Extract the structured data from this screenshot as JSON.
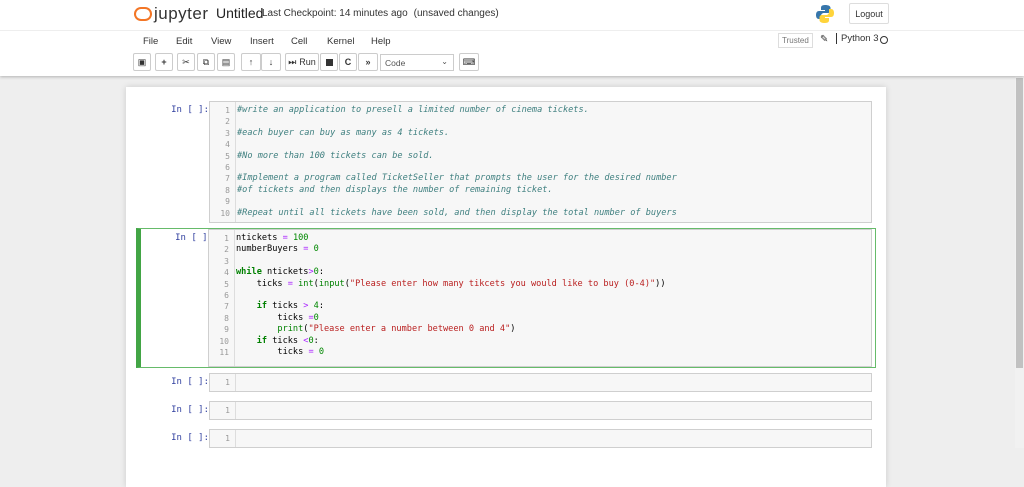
{
  "header": {
    "logo": "jupyter",
    "notebook_name": "Untitled",
    "checkpoint": "Last Checkpoint: 14 minutes ago",
    "unsaved": "(unsaved changes)",
    "logout": "Logout"
  },
  "menu": [
    "File",
    "Edit",
    "View",
    "Insert",
    "Cell",
    "Kernel",
    "Help"
  ],
  "kernel": {
    "trusted": "Trusted",
    "name": "Python 3"
  },
  "toolbar": {
    "run": "Run",
    "cell_type": "Code"
  },
  "cells": [
    {
      "prompt": "In [ ]:",
      "lines": [
        [
          [
            "#write an application to presell a limited number of cinema tickets.",
            "c"
          ]
        ],
        [],
        [
          [
            "#each buyer can buy as many as 4 tickets.",
            "c"
          ]
        ],
        [],
        [
          [
            "#No more than 100 tickets can be sold.",
            "c"
          ]
        ],
        [],
        [
          [
            "#Implement a program called TicketSeller that prompts the user for the desired number",
            "c"
          ]
        ],
        [
          [
            "#of tickets and then displays the number of remaining ticket.",
            "c"
          ]
        ],
        [],
        [
          [
            "#Repeat until all tickets have been sold, and then display the total number of buyers",
            "c"
          ]
        ]
      ]
    },
    {
      "prompt": "In [ ]:",
      "lines": [
        [
          [
            "ntickets ",
            ""
          ],
          [
            "=",
            "o"
          ],
          [
            " ",
            ""
          ],
          [
            "100",
            "n"
          ]
        ],
        [
          [
            "numberBuyers ",
            ""
          ],
          [
            "=",
            "o"
          ],
          [
            " ",
            ""
          ],
          [
            "0",
            "n"
          ]
        ],
        [],
        [
          [
            "while",
            "k"
          ],
          [
            " ntickets",
            ""
          ],
          [
            ">",
            "o"
          ],
          [
            "0",
            "n"
          ],
          [
            ":",
            ""
          ]
        ],
        [
          [
            "    ticks ",
            ""
          ],
          [
            "=",
            "o"
          ],
          [
            " ",
            ""
          ],
          [
            "int",
            "b"
          ],
          [
            "(",
            ""
          ],
          [
            "input",
            "b"
          ],
          [
            "(",
            ""
          ],
          [
            "\"Please enter how many tikcets you would like to buy (0-4)\"",
            "s"
          ],
          [
            "))",
            ""
          ]
        ],
        [],
        [
          [
            "    ",
            ""
          ],
          [
            "if",
            "k"
          ],
          [
            " ticks ",
            ""
          ],
          [
            ">",
            "o"
          ],
          [
            " ",
            ""
          ],
          [
            "4",
            "n"
          ],
          [
            ":",
            ""
          ]
        ],
        [
          [
            "        ticks ",
            ""
          ],
          [
            "=",
            "o"
          ],
          [
            "0",
            "n"
          ]
        ],
        [
          [
            "        ",
            ""
          ],
          [
            "print",
            "b"
          ],
          [
            "(",
            ""
          ],
          [
            "\"Please enter a number between 0 and 4\"",
            "s"
          ],
          [
            ")",
            ""
          ]
        ],
        [
          [
            "    ",
            ""
          ],
          [
            "if",
            "k"
          ],
          [
            " ticks ",
            ""
          ],
          [
            "<",
            "o"
          ],
          [
            "0",
            "n"
          ],
          [
            ":",
            ""
          ]
        ],
        [
          [
            "        ticks ",
            ""
          ],
          [
            "=",
            "o"
          ],
          [
            " ",
            ""
          ],
          [
            "0",
            "n"
          ]
        ]
      ]
    },
    {
      "prompt": "In [ ]:",
      "lines": [
        []
      ]
    },
    {
      "prompt": "In [ ]:",
      "lines": [
        []
      ]
    },
    {
      "prompt": "In [ ]:",
      "lines": [
        []
      ]
    }
  ]
}
